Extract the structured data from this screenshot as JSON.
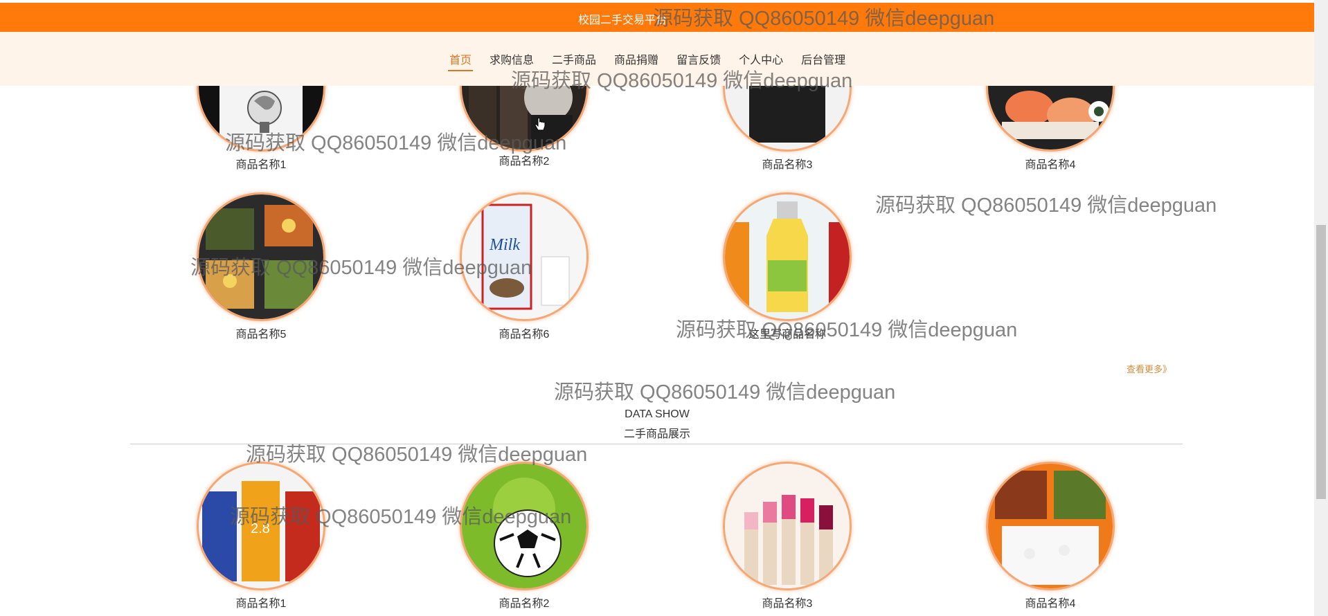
{
  "header": {
    "site_title": "校园二手交易平台"
  },
  "nav": {
    "items": [
      "首页",
      "求购信息",
      "二手商品",
      "商品捐赠",
      "留言反馈",
      "个人中心",
      "后台管理"
    ],
    "active_index": 0
  },
  "section1": {
    "products": [
      "商品名称1",
      "商品名称2",
      "商品名称3",
      "商品名称4",
      "商品名称5",
      "商品名称6",
      "这里写商品名称"
    ],
    "more_label": "查看更多》"
  },
  "section2": {
    "title_en": "DATA SHOW",
    "title_cn": "二手商品展示",
    "products": [
      "商品名称1",
      "商品名称2",
      "商品名称3",
      "商品名称4"
    ]
  },
  "watermark": "源码获取 QQ86050149 微信deepguan",
  "icons": {
    "more_link": "double-chevron-right-icon",
    "cursor": "hand-pointer-icon"
  },
  "colors": {
    "header_orange": "#ff7a0a",
    "nav_bg": "#fff4ea",
    "accent": "#e07322",
    "circle_border": "#f5a774"
  }
}
